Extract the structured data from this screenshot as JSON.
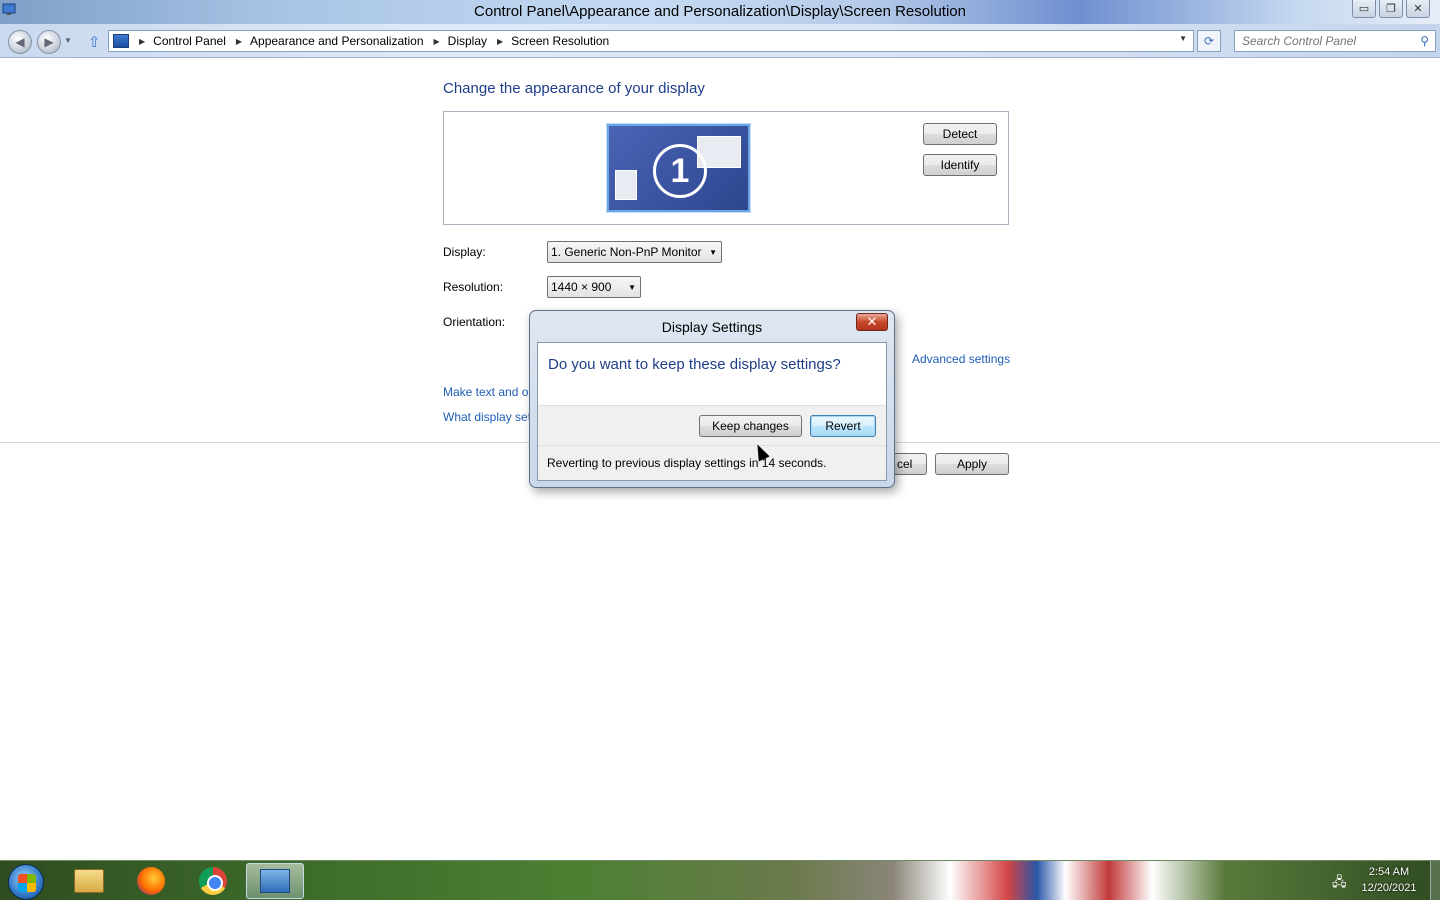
{
  "window": {
    "title": "Control Panel\\Appearance and Personalization\\Display\\Screen Resolution",
    "controls": {
      "minimize": "▭",
      "restore": "❐",
      "close": "✕"
    }
  },
  "address_bar": {
    "breadcrumbs": [
      "Control Panel",
      "Appearance and Personalization",
      "Display",
      "Screen Resolution"
    ],
    "search_placeholder": "Search Control Panel"
  },
  "main": {
    "heading": "Change the appearance of your display",
    "monitor_number": "1",
    "detect_label": "Detect",
    "identify_label": "Identify",
    "display_label": "Display:",
    "display_value": "1. Generic Non-PnP Monitor",
    "resolution_label": "Resolution:",
    "resolution_value": "1440 × 900",
    "orientation_label": "Orientation:",
    "advanced_settings": "Advanced settings",
    "link_text_size": "Make text and o",
    "link_display_settings": "What display set",
    "cancel_partial": "cel",
    "apply_label": "Apply"
  },
  "dialog": {
    "title": "Display Settings",
    "close": "✕",
    "question": "Do you want to keep these display settings?",
    "keep_label": "Keep changes",
    "revert_label": "Revert",
    "status": "Reverting to previous display settings in 14 seconds."
  },
  "taskbar": {
    "time": "2:54 AM",
    "date": "12/20/2021"
  },
  "colors": {
    "heading": "#1e3f88",
    "link": "#1e5eb5",
    "dialog_close": "#c8472b"
  }
}
